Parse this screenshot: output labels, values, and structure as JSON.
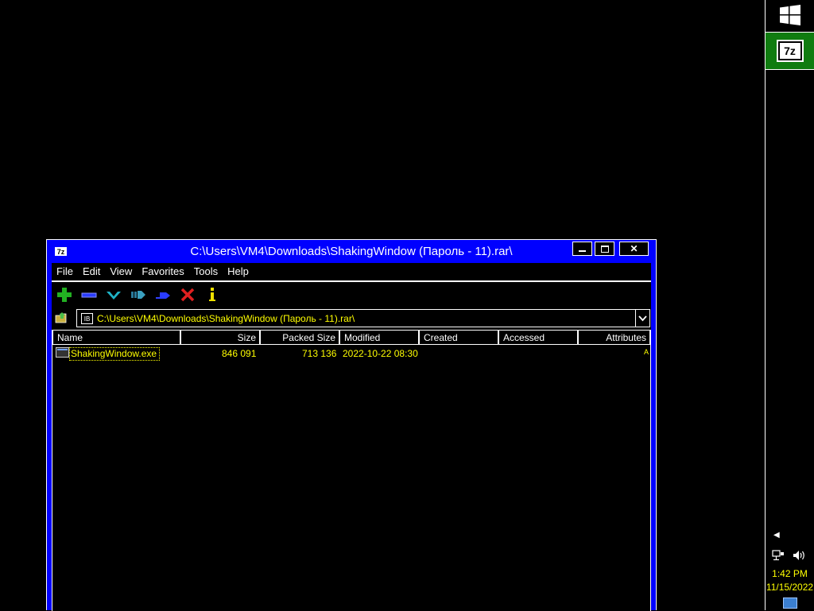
{
  "taskbar": {
    "start_icon": "windows-logo-icon",
    "app_button": {
      "icon": "7zip-icon",
      "label": "7z"
    },
    "tray": {
      "overflow_icon": "chevron-left-icon",
      "network_icon": "network-icon",
      "volume_icon": "speaker-icon",
      "time": "1:42 PM",
      "date": "11/15/2022",
      "notification_icon": "notification-icon"
    }
  },
  "window": {
    "title": "C:\\Users\\VM4\\Downloads\\ShakingWindow (Пароль - 11).rar\\",
    "title_icon": "7z",
    "controls": {
      "minimize": "▁",
      "maximize": "□",
      "close": "✕"
    },
    "menu": [
      "File",
      "Edit",
      "View",
      "Favorites",
      "Tools",
      "Help"
    ],
    "toolbar": [
      "add-icon",
      "extract-icon",
      "test-icon",
      "copy-icon",
      "move-icon",
      "delete-icon",
      "info-icon"
    ],
    "address": {
      "path": "C:\\Users\\VM4\\Downloads\\ShakingWindow (Пароль - 11).rar\\"
    },
    "list": {
      "columns": [
        "Name",
        "Size",
        "Packed Size",
        "Modified",
        "Created",
        "Accessed",
        "Attributes"
      ],
      "rows": [
        {
          "name": "ShakingWindow.exe",
          "size": "846 091",
          "packed_size": "713 136",
          "modified": "2022-10-22 08:30",
          "created": "",
          "accessed": "",
          "attributes": "A"
        }
      ]
    }
  },
  "colors": {
    "desktop": "#000000",
    "window_frame": "#0000ff",
    "highlight_text": "#ffff00",
    "taskbar_active": "#107c10"
  }
}
